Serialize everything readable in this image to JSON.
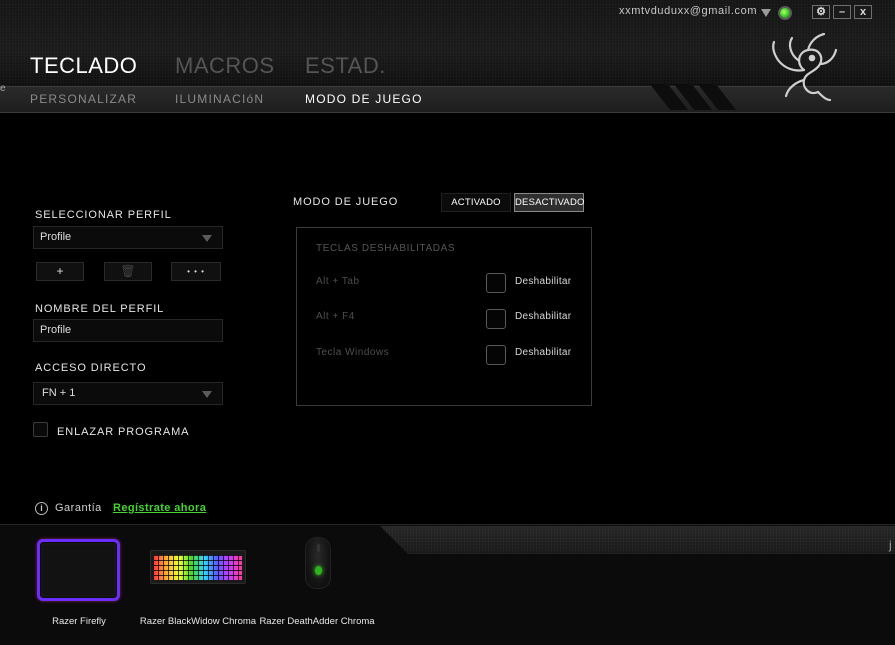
{
  "window": {
    "user_email": "xxmtvduduxx@gmail.com",
    "buttons": {
      "settings": "⚙",
      "minimize": "–",
      "close": "x"
    }
  },
  "main_tabs": [
    {
      "label": "TECLADO",
      "active": true
    },
    {
      "label": "MACROS",
      "active": false
    },
    {
      "label": "ESTAD.",
      "active": false
    }
  ],
  "sub_tabs": [
    {
      "label": "PERSONALIZAR",
      "active": false
    },
    {
      "label": "ILUMINACIóN",
      "active": false
    },
    {
      "label": "MODO DE JUEGO",
      "active": true
    }
  ],
  "profile": {
    "select_label": "SELECCIONAR PERFIL",
    "selected": "Profile",
    "add_symbol": "+",
    "delete_symbol": "🗑",
    "more_symbol": "• • •",
    "name_label": "NOMBRE DEL PERFIL",
    "name_value": "Profile",
    "shortcut_label": "ACCESO DIRECTO",
    "shortcut_value": "FN + 1",
    "link_program_label": "ENLAZAR PROGRAMA"
  },
  "game_mode": {
    "label": "MODO DE JUEGO",
    "on_label": "ACTIVADO",
    "off_label": "DESACTIVADO",
    "selected": "DESACTIVADO",
    "panel_title": "TECLAS DESHABILITADAS",
    "keys": [
      {
        "name": "Alt + Tab",
        "action": "Deshabilitar",
        "checked": false
      },
      {
        "name": "Alt + F4",
        "action": "Deshabilitar",
        "checked": false
      },
      {
        "name": "Tecla Windows",
        "action": "Deshabilitar",
        "checked": false
      }
    ]
  },
  "warranty": {
    "icon": "i",
    "label": "Garantía",
    "link": "Regístrate ahora"
  },
  "devices": [
    {
      "name": "Razer Firefly"
    },
    {
      "name": "Razer BlackWidow Chroma"
    },
    {
      "name": "Razer DeathAdder Chroma"
    }
  ],
  "edge_marks": {
    "left": "e",
    "right": "j"
  },
  "colors": {
    "accent": "#44d62c",
    "background": "#000000"
  }
}
